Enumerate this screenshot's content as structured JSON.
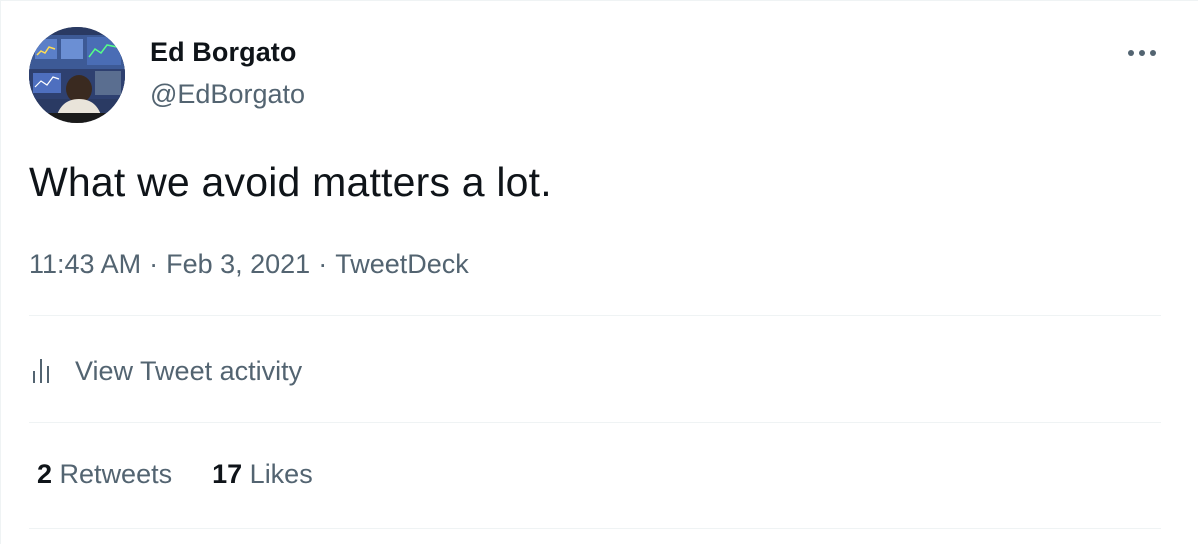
{
  "author": {
    "name": "Ed Borgato",
    "handle": "@EdBorgato",
    "avatar_icon": "avatar-trading-screens"
  },
  "menu": {
    "icon": "more-dots-icon"
  },
  "tweet": {
    "text": "What we avoid matters a lot.",
    "time": "11:43 AM",
    "date": "Feb 3, 2021",
    "source": "TweetDeck",
    "separator": "·"
  },
  "activity": {
    "label": "View Tweet activity",
    "icon": "bar-chart-icon"
  },
  "stats": {
    "retweets_count": "2",
    "retweets_label": "Retweets",
    "likes_count": "17",
    "likes_label": "Likes"
  },
  "colors": {
    "text_primary": "#0f1419",
    "text_secondary": "#536471",
    "divider": "#eff3f4",
    "background": "#ffffff"
  }
}
